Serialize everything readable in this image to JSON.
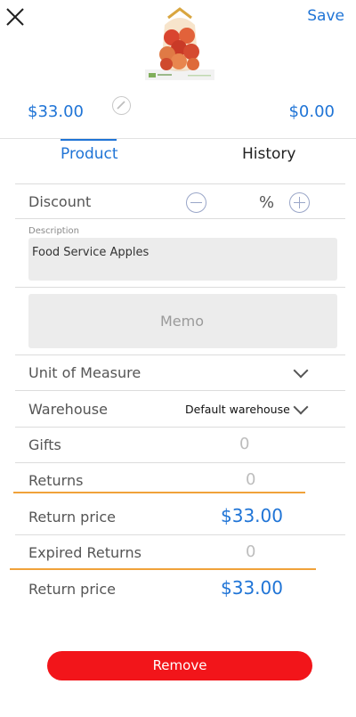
{
  "header": {
    "save_label": "Save",
    "price_left": "$33.00",
    "price_right": "$0.00"
  },
  "tabs": [
    {
      "label": "Product",
      "active": true
    },
    {
      "label": "History",
      "active": false
    }
  ],
  "discount": {
    "label": "Discount",
    "percent_symbol": "%"
  },
  "description": {
    "label": "Description",
    "value": "Food Service Apples"
  },
  "memo": {
    "placeholder": "Memo"
  },
  "unit_of_measure": {
    "label": "Unit of Measure"
  },
  "warehouse": {
    "label": "Warehouse",
    "value": "Default warehouse"
  },
  "gifts": {
    "label": "Gifts",
    "value": "0"
  },
  "returns": {
    "label": "Returns",
    "value": "0"
  },
  "return_price_1": {
    "label": "Return price",
    "value": "$33.00"
  },
  "expired_returns": {
    "label": "Expired Returns",
    "value": "0"
  },
  "return_price_2": {
    "label": "Return price",
    "value": "$33.00"
  },
  "remove_label": "Remove",
  "colors": {
    "accent": "#1f74d6",
    "remove": "#f2151a",
    "highlight": "#f0a23a"
  }
}
